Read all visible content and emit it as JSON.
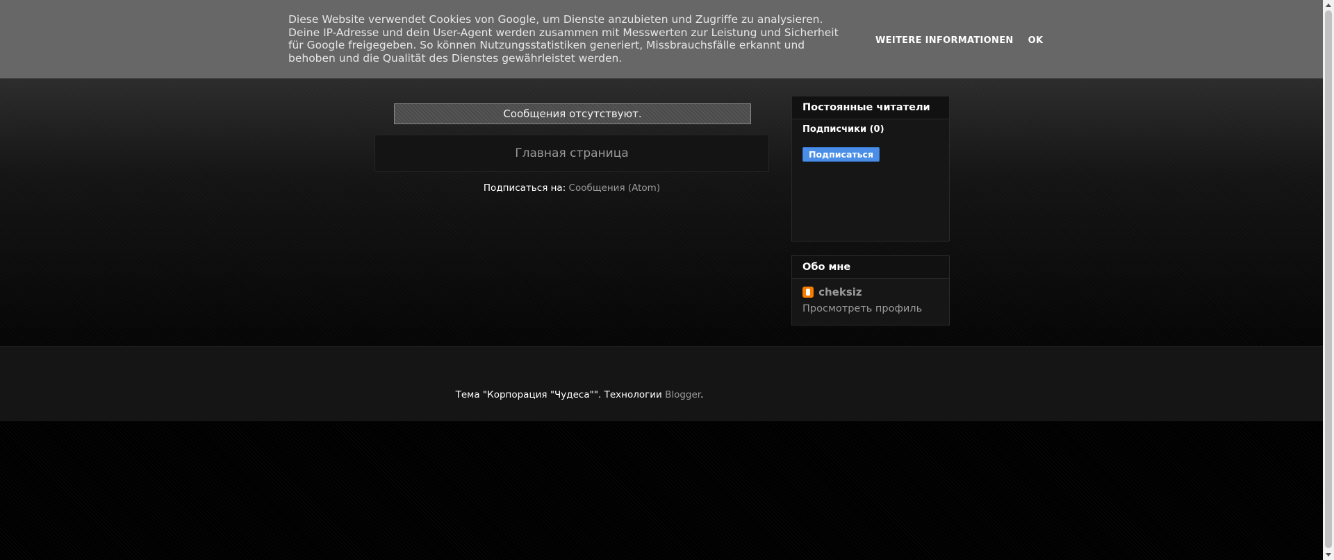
{
  "cookie_banner": {
    "text": "Diese Website verwendet Cookies von Google, um Dienste anzubieten und Zugriffe zu analysieren. Deine IP-Adresse und dein User-Agent werden zusammen mit Messwerten zur Leistung und Sicherheit für Google freigegeben. So können Nutzungsstatistiken generiert, Missbrauchsfälle erkannt und behoben und die Qualität des Dienstes gewährleistet werden.",
    "more_info_label": "WEITERE INFORMATIONEN",
    "ok_label": "OK"
  },
  "main": {
    "no_posts": "Сообщения отсутствуют.",
    "home_link": "Главная страница",
    "subscribe_prefix": "Подписаться на:",
    "atom_link": "Сообщения (Atom)"
  },
  "sidebar": {
    "followers": {
      "title": "Постоянные читатели",
      "count_label": "Подписчики (0)",
      "follow_button": "Подписаться"
    },
    "about": {
      "title": "Обо мне",
      "profile_name": "cheksiz",
      "view_profile": "Просмотреть профиль"
    }
  },
  "footer": {
    "theme_text": "Тема \"Корпорация \"Чудеса\"\". Технологии ",
    "blogger_link": "Blogger",
    "period": "."
  },
  "colors": {
    "cookie_bar": "#676767",
    "follow_button": "#4a8ee8",
    "blogger_icon": "#f57d00",
    "link_gray": "#9a9a9a"
  },
  "icons": {
    "blogger": "blogger-icon"
  }
}
